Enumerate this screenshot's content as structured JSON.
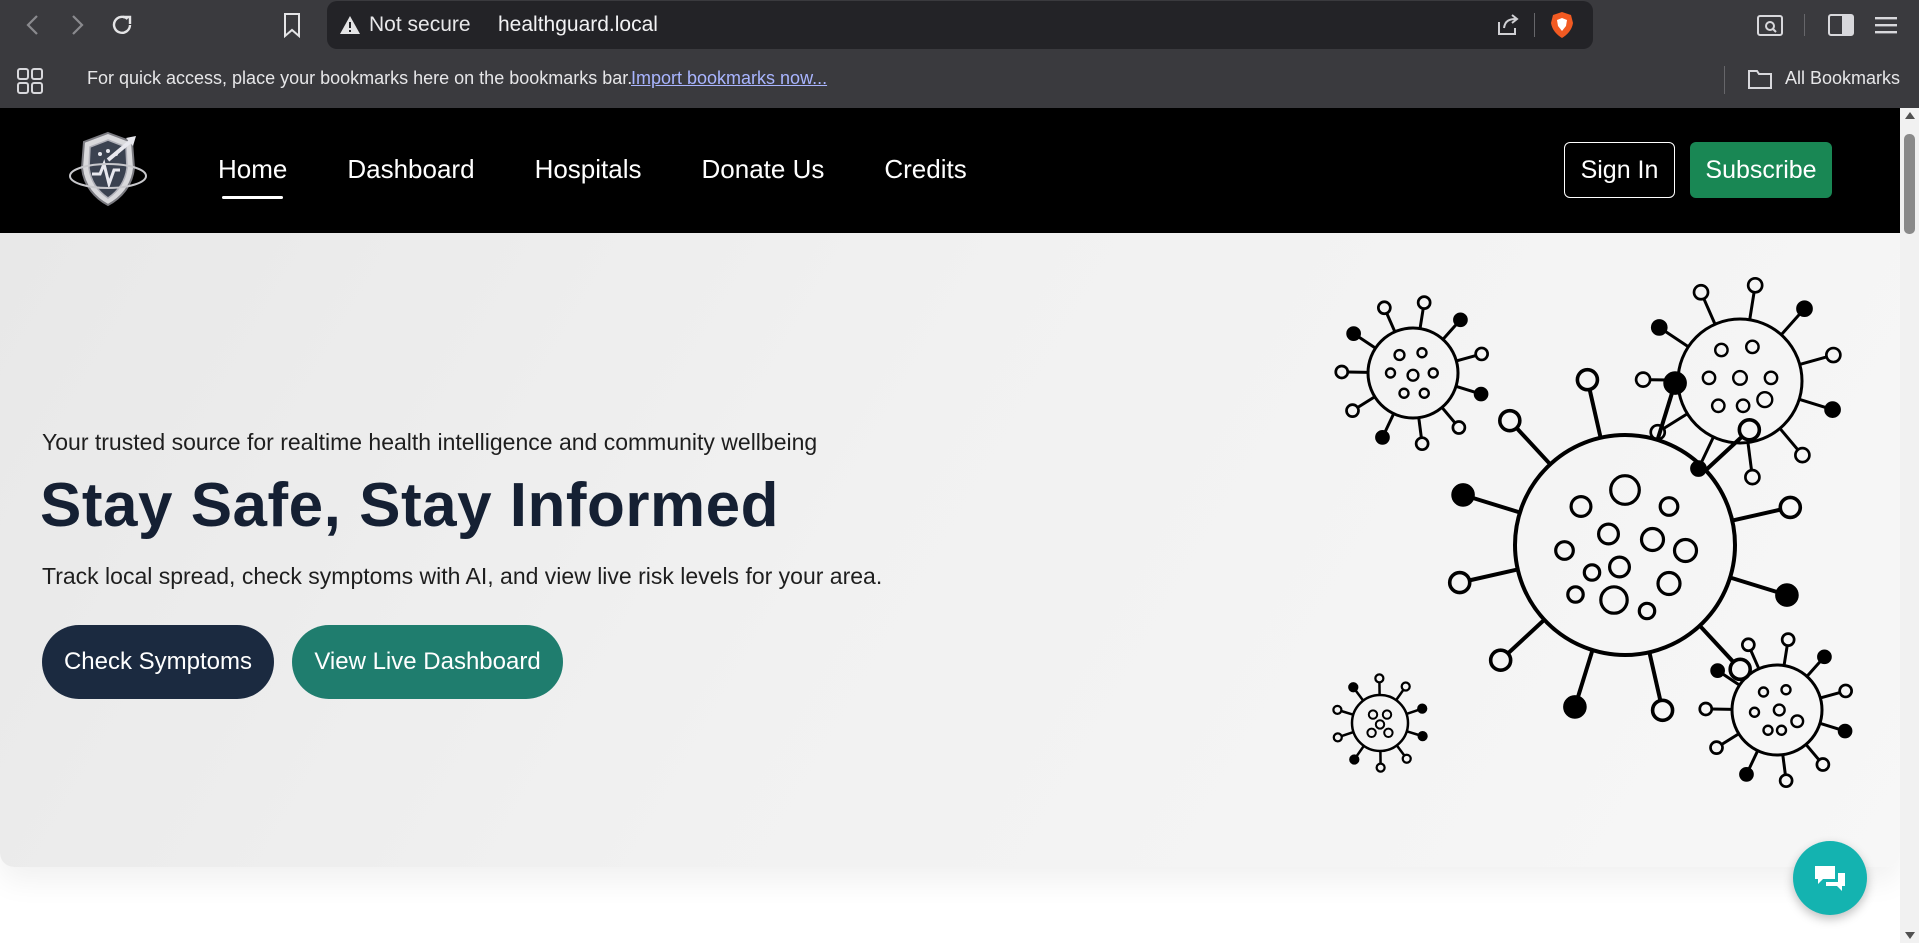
{
  "browser": {
    "security_label": "Not secure",
    "url": "healthguard.local",
    "bookmarks_prompt": "For quick access, place your bookmarks here on the bookmarks bar.",
    "import_link": "Import bookmarks now...",
    "all_bookmarks": "All Bookmarks"
  },
  "site": {
    "nav": [
      {
        "label": "Home",
        "active": true
      },
      {
        "label": "Dashboard"
      },
      {
        "label": "Hospitals"
      },
      {
        "label": "Donate Us"
      },
      {
        "label": "Credits"
      }
    ],
    "sign_in": "Sign In",
    "subscribe": "Subscribe",
    "subscribe_color": "#198754"
  },
  "hero": {
    "tagline": "Your trusted source for realtime health intelligence and community wellbeing",
    "title": "Stay Safe, Stay Informed",
    "description": "Track local spread, check symptoms with AI, and view live risk levels for your area.",
    "primary_button": "Check Symptoms",
    "secondary_button": "View Live Dashboard",
    "primary_color": "#1b2a40",
    "secondary_color": "#1f7d6e"
  },
  "chat": {
    "icon": "chat-bubbles-icon",
    "color": "#14b3b0"
  }
}
